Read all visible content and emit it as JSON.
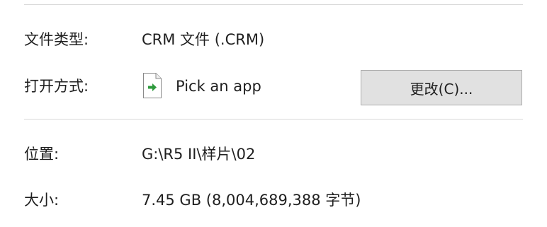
{
  "properties": {
    "file_type": {
      "label": "文件类型:",
      "value": "CRM 文件 (.CRM)"
    },
    "open_with": {
      "label": "打开方式:",
      "app_name": "Pick an app",
      "app_icon": "file-green-arrow-icon",
      "change_button": "更改(C)..."
    },
    "location": {
      "label": "位置:",
      "value": "G:\\R5 II\\样片\\02"
    },
    "size": {
      "label": "大小:",
      "value": "7.45 GB (8,004,689,388 字节)"
    }
  },
  "colors": {
    "divider": "#d9d9d9",
    "button_bg": "#e1e1e1",
    "button_border": "#adadad",
    "icon_arrow": "#2e9a3c"
  }
}
